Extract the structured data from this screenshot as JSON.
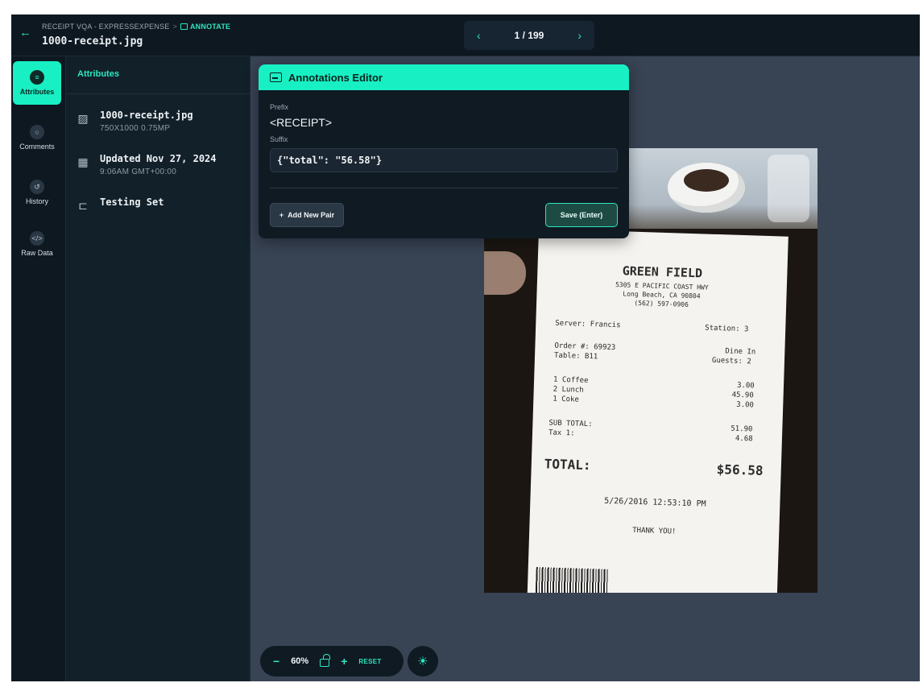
{
  "header": {
    "back_icon": "arrow-left-icon",
    "breadcrumb": {
      "project": "RECEIPT VQA - EXPRESSEXPENSE",
      "separator": ">",
      "current": "ANNOTATE"
    },
    "filename": "1000-receipt.jpg"
  },
  "pager": {
    "prev_icon": "chevron-left-icon",
    "next_icon": "chevron-right-icon",
    "label": "1 / 199"
  },
  "rail": {
    "items": [
      {
        "label": "Attributes",
        "icon": "list-icon",
        "active": true
      },
      {
        "label": "Comments",
        "icon": "comment-icon",
        "active": false
      },
      {
        "label": "History",
        "icon": "history-icon",
        "active": false
      },
      {
        "label": "Raw Data",
        "icon": "code-icon",
        "active": false
      }
    ]
  },
  "attributes": {
    "title": "Attributes",
    "file": {
      "name": "1000-receipt.jpg",
      "meta": "750X1000  0.75MP"
    },
    "updated": {
      "label": "Updated Nov 27, 2024",
      "meta": "9:06AM  GMT+00:00"
    },
    "set": {
      "label": "Testing Set"
    }
  },
  "editor": {
    "title": "Annotations Editor",
    "prefix_label": "Prefix",
    "prefix_value": "<RECEIPT>",
    "suffix_label": "Suffix",
    "suffix_value": "{\"total\": \"56.58\"}",
    "add_button": "Add New Pair",
    "save_button": "Save (Enter)"
  },
  "receipt": {
    "store": "GREEN FIELD",
    "address1": "5305 E PACIFIC COAST HWY",
    "address2": "Long Beach, CA 90804",
    "phone": "(562) 597-0906",
    "server": "Server: Francis",
    "station": "Station: 3",
    "order": "Order #: 69923",
    "dine": "Dine In",
    "table": "Table: B11",
    "guests": "Guests: 2",
    "items": [
      {
        "name": "1 Coffee",
        "price": "3.00"
      },
      {
        "name": "2 Lunch",
        "price": "45.90"
      },
      {
        "name": "1 Coke",
        "price": "3.00"
      }
    ],
    "subtotal_label": "SUB TOTAL:",
    "subtotal": "51.90",
    "tax_label": "Tax 1:",
    "tax": "4.68",
    "total_label": "TOTAL:",
    "total": "$56.58",
    "datetime": "5/26/2016 12:53:10 PM",
    "thanks": "THANK YOU!"
  },
  "zoom": {
    "minus": "−",
    "level": "60%",
    "plus": "+",
    "reset": "RESET",
    "lock_icon": "unlock-icon",
    "brightness_icon": "brightness-icon"
  },
  "colors": {
    "accent": "#18f0c4",
    "panel": "#122029",
    "canvas": "#384354"
  }
}
